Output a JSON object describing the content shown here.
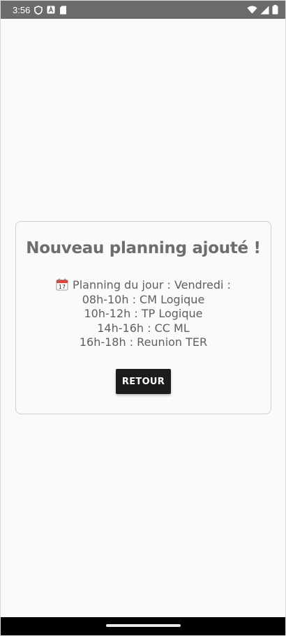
{
  "status_bar": {
    "time": "3:56",
    "icons": [
      "shield-icon",
      "a-font-icon",
      "sd-card-icon",
      "wifi-icon",
      "signal-icon",
      "battery-icon"
    ]
  },
  "card": {
    "title": "Nouveau planning ajouté !",
    "planning_header": "Planning du jour : Vendredi :",
    "calendar_icon": "calendar-icon",
    "entries": [
      "08h-10h : CM Logique",
      "10h-12h : TP Logique",
      "14h-16h : CC ML",
      "16h-18h : Reunion TER"
    ],
    "button_label": "RETOUR"
  },
  "colors": {
    "status_bar_bg": "#6b6b6b",
    "page_bg": "#fafafa",
    "title_text": "#6d6d6d",
    "body_text": "#5f5f5f",
    "button_bg": "#1c1c1c",
    "button_text": "#ffffff",
    "nav_bar_bg": "#000000"
  }
}
